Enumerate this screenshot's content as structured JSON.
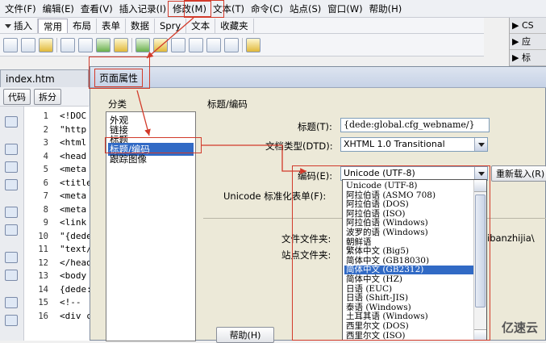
{
  "menubar": {
    "items": [
      "文件(F)",
      "编辑(E)",
      "查看(V)",
      "插入记录(I)",
      "修改(M)",
      "文本(T)",
      "命令(C)",
      "站点(S)",
      "窗口(W)",
      "帮助(H)"
    ]
  },
  "insertbar": {
    "label": "插入",
    "tabs": [
      "常用",
      "布局",
      "表单",
      "数据",
      "Spry",
      "文本",
      "收藏夹"
    ]
  },
  "rightpanel": {
    "items": [
      "CS",
      "应",
      "标"
    ]
  },
  "document": {
    "tab_name": "index.htm",
    "code_button": "代码",
    "split_button": "拆分",
    "line_numbers": [
      "1",
      "2",
      "3",
      "4",
      "5",
      "6",
      "7",
      "8",
      "9",
      "10",
      "11",
      "12",
      "13",
      "14",
      "15",
      "16"
    ],
    "code_lines": [
      "<!DOC",
      "\"http",
      "<html",
      "<head",
      "<meta",
      "<title",
      "<meta",
      "<meta",
      "<link",
      "\"{dede",
      "\"text/",
      "</head",
      "<body",
      "{dede:",
      "<!-- ",
      "<div c"
    ]
  },
  "dialog": {
    "title": "页面属性",
    "category_label": "分类",
    "categories": [
      "外观",
      "链接",
      "标题",
      "标题/编码",
      "跟踪图像"
    ],
    "section_title": "标题/编码",
    "title_label": "标题(T):",
    "title_value": "{dede:global.cfg_webname/}",
    "doctype_label": "文档类型(DTD):",
    "doctype_value": "XHTML 1.0 Transitional",
    "encoding_label": "编码(E):",
    "encoding_value": "Unicode (UTF-8)",
    "reload_button": "重新载入(R)",
    "normalization_label": "Unicode 标准化表单(F):",
    "doc_folder_label": "文件文件夹:",
    "doc_folder_value": "ibanzhijia\\",
    "site_folder_label": "站点文件夹:",
    "help_button": "帮助(H)",
    "encoding_options": [
      "Unicode (UTF-8)",
      "阿拉伯语 (ASMO 708)",
      "阿拉伯语 (DOS)",
      "阿拉伯语 (ISO)",
      "阿拉伯语 (Windows)",
      "波罗的语 (Windows)",
      "朝鲜语",
      "繁体中文 (Big5)",
      "简体中文 (GB18030)",
      "简体中文 (GB2312)",
      "简体中文 (HZ)",
      "日语 (EUC)",
      "日语 (Shift-JIS)",
      "泰语 (Windows)",
      "土耳其语 (Windows)",
      "西里尔文 (DOS)",
      "西里尔文 (ISO)"
    ],
    "selected_option": "简体中文 (GB2312)"
  },
  "watermark": "亿速云",
  "colors": {
    "selection": "#316ac5",
    "annotation": "#d23a2a"
  }
}
